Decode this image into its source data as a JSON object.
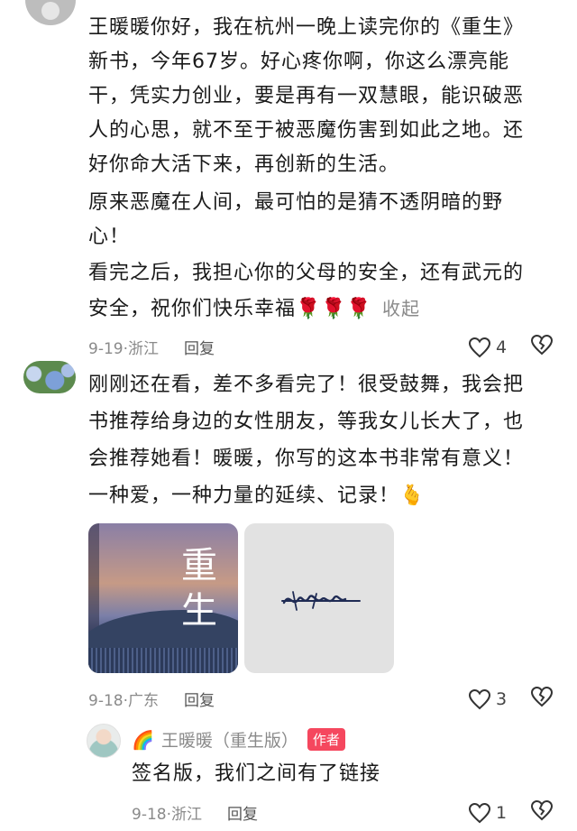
{
  "comment1": {
    "lines": [
      "王暖暖你好，我在杭州一晚上读完你的《重生》",
      "新书，今年67岁。好心疼你啊，你这么漂亮能",
      "干，凭实力创业，要是再有一双慧眼，能识破恶",
      "人的心思，就不至于被恶魔伤害到如此之地。还",
      "好你命大活下来，再创新的生活。",
      "原来恶魔在人间，最可怕的是猜不透阴暗的野",
      "心！",
      "看完之后，我担心你的父母的安全，还有武元的",
      "安全，祝你们快乐幸福"
    ],
    "emoji": "🌹",
    "collapse_label": "收起",
    "date_location": "9-19·浙江",
    "reply_label": "回复",
    "like_count": "4"
  },
  "comment2": {
    "lines": [
      "刚刚还在看，差不多看完了！很受鼓舞，我会把",
      "书推荐给身边的女性朋友，等我女儿长大了，也",
      "会推荐她看！暖暖，你写的这本书非常有意义！",
      "一种爱，一种力量的延续、记录！"
    ],
    "emoji": "🫰",
    "book_title": "重生",
    "date_location": "9-18·广东",
    "reply_label": "回复",
    "like_count": "3"
  },
  "reply": {
    "author_emoji": "🌈",
    "author_name": "王暖暖（重生版）",
    "badge": "作者",
    "text": "签名版，我们之间有了链接",
    "date_location": "9-18·浙江",
    "reply_label": "回复",
    "like_count": "1"
  },
  "icons": {
    "like": "heart-outline-icon",
    "dislike": "broken-heart-icon"
  }
}
